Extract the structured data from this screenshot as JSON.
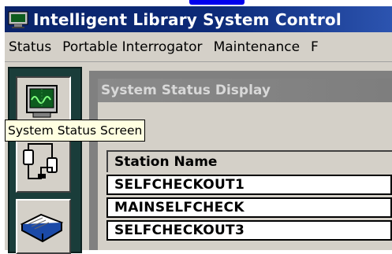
{
  "window": {
    "title": "Intelligent Library System Control"
  },
  "menu": {
    "items": [
      "Status",
      "Portable Interrogator",
      "Maintenance",
      "F"
    ]
  },
  "toolbar": {
    "buttons": [
      {
        "icon": "oscilloscope-icon"
      },
      {
        "icon": "connected-devices-icon"
      },
      {
        "icon": "book-icon"
      }
    ]
  },
  "tooltip": {
    "text": "System Status Screen"
  },
  "panel": {
    "title": "System Status Display",
    "table": {
      "column_header": "Station Name",
      "rows": [
        "SELFCHECKOUT1",
        "MAINSELFCHECK",
        "SELFCHECKOUT3"
      ]
    }
  },
  "colors": {
    "titlebar": "#0a246a",
    "toolbar_bg": "#1a3d3a",
    "scope_screen": "#0d5c1e",
    "tooltip_bg": "#ffffe1"
  }
}
